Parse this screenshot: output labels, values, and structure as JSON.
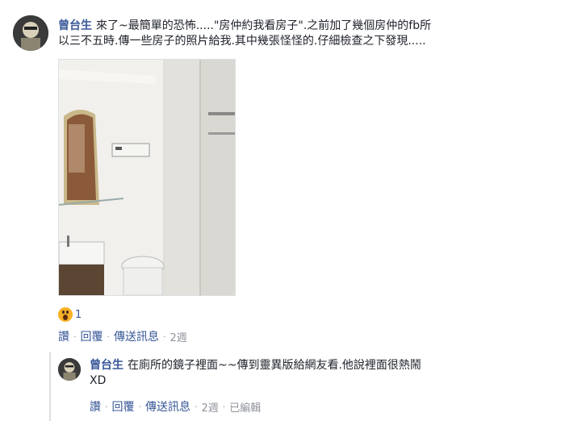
{
  "comment": {
    "author": "曾台生",
    "text_line1": "來了~最簡單的恐怖.....\"房仲約我看房子\".之前加了幾個房仲的fb所",
    "text_line2": "以三不五時.傳一些房子的照片給我.其中幾張怪怪的.仔細檢查之下發現.....",
    "reaction_count": "1",
    "reaction_icon": "wow-emoji-icon",
    "actions": {
      "like": "讚",
      "reply": "回覆",
      "message": "傳送訊息",
      "time": "2週"
    }
  },
  "reply": {
    "author": "曾台生",
    "text_line1": "在廁所的鏡子裡面~~傳到靈異版給網友看.他說裡面很熱鬧",
    "text_line2": "XD",
    "actions": {
      "like": "讚",
      "reply": "回覆",
      "message": "傳送訊息",
      "time": "2週",
      "edited": "已編輯"
    }
  },
  "colors": {
    "link": "#385898",
    "meta": "#90949c",
    "text": "#1d2129",
    "reaction": "#f7b125"
  }
}
